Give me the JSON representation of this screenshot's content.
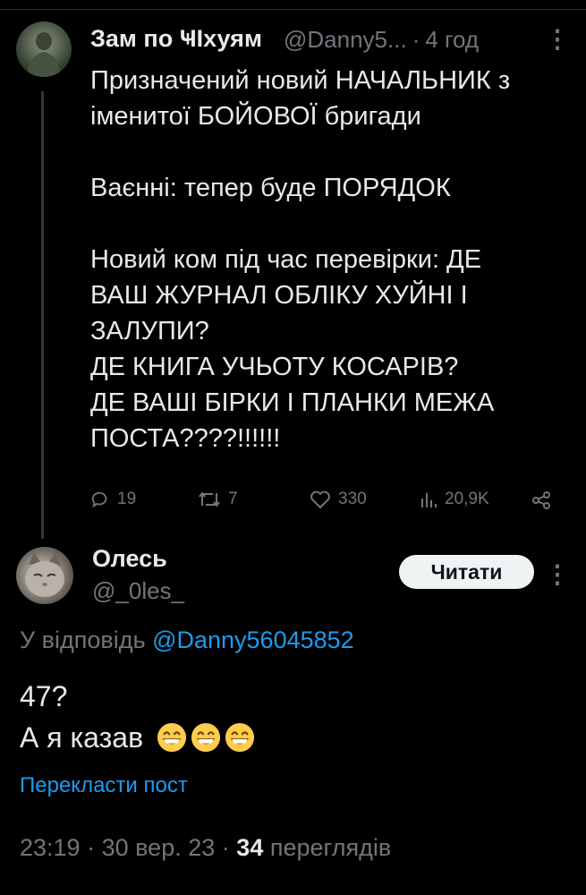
{
  "tweet": {
    "author_name": "Зам по ҸІхуям",
    "author_handle": "@Danny5...",
    "time_ago": "4 год",
    "separator": "·",
    "text": "Призначений новий НАЧАЛЬНИК з\nіменитої БОЙОВОЇ бригади\n\nВаєнні: тепер буде ПОРЯДОК\n\nНовий ком під час перевірки: ДЕ\nВАШ ЖУРНАЛ ОБЛІКУ ХУЙНІ І\nЗАЛУПИ?\nДЕ КНИГА УЧЬОТУ КОСАРІВ?\nДЕ ВАШІ БІРКИ І ПЛАНКИ МЕЖА\nПОСТА????!!!!!!",
    "actions": {
      "replies": "19",
      "reposts": "7",
      "likes": "330",
      "views": "20,9K"
    }
  },
  "reply": {
    "author_name": "Олесь",
    "author_handle": "@_0les_",
    "follow_label": "Читати",
    "reply_prefix": "У відповідь",
    "reply_mention": "@Danny56045852",
    "line1": "47?",
    "line2": "А я казав",
    "emoji_name": "grinning-face-with-smiling-eyes",
    "translate_label": "Перекласти пост",
    "time": "23:19",
    "date": "30 вер. 23",
    "views_count": "34",
    "views_label": "переглядів"
  },
  "colors": {
    "background": "#000000",
    "text": "#e7e9ea",
    "muted": "#71767b",
    "link": "#1d9bf0",
    "button_bg": "#eff3f4"
  }
}
